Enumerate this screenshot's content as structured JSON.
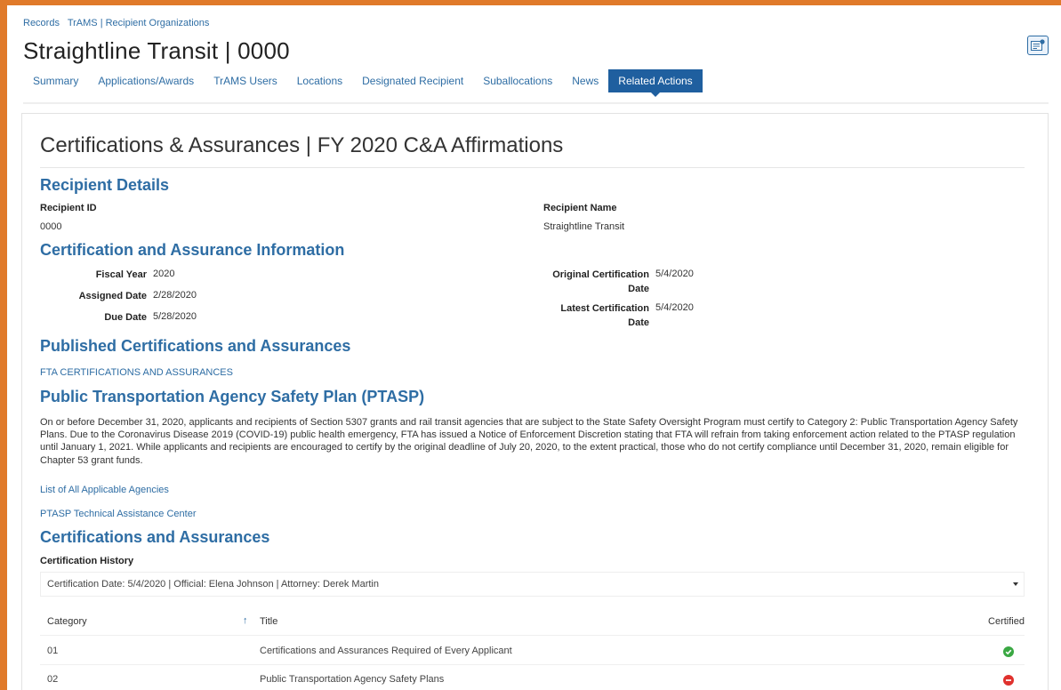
{
  "breadcrumb": [
    "Records",
    "TrAMS | Recipient Organizations"
  ],
  "page_title": "Straightline Transit | 0000",
  "tabs": [
    {
      "label": "Summary"
    },
    {
      "label": "Applications/Awards"
    },
    {
      "label": "TrAMS Users"
    },
    {
      "label": "Locations"
    },
    {
      "label": "Designated Recipient"
    },
    {
      "label": "Suballocations"
    },
    {
      "label": "News"
    },
    {
      "label": "Related Actions",
      "active": true
    }
  ],
  "report_icon": "report-icon",
  "main": {
    "title": "Certifications & Assurances | FY 2020 C&A Affirmations",
    "recipient_details": {
      "heading": "Recipient Details",
      "id_label": "Recipient ID",
      "id_value": "0000",
      "name_label": "Recipient Name",
      "name_value": "Straightline Transit"
    },
    "cert_info": {
      "heading": "Certification and Assurance Information",
      "fiscal_year_label": "Fiscal Year",
      "fiscal_year_value": "2020",
      "assigned_date_label": "Assigned Date",
      "assigned_date_value": "2/28/2020",
      "due_date_label": "Due Date",
      "due_date_value": "5/28/2020",
      "original_cert_label": "Original Certification Date",
      "original_cert_value": "5/4/2020",
      "latest_cert_label": "Latest Certification Date",
      "latest_cert_value": "5/4/2020"
    },
    "published": {
      "heading": "Published Certifications and Assurances",
      "link": "FTA CERTIFICATIONS AND ASSURANCES"
    },
    "ptasp": {
      "heading": "Public Transportation Agency Safety Plan (PTASP)",
      "paragraph": "On or before December 31, 2020, applicants and recipients of Section 5307 grants and rail transit agencies that are subject to the State Safety Oversight Program must certify to Category 2: Public Transportation Agency Safety Plans. Due to the Coronavirus Disease 2019 (COVID-19) public health emergency, FTA has issued a Notice of Enforcement Discretion stating that FTA will refrain from taking enforcement action related to the PTASP regulation until January 1, 2021. While applicants and recipients are encouraged to certify by the original deadline of July 20, 2020, to the extent practical, those who do not certify compliance until December 31, 2020, remain eligible for Chapter 53 grant funds.",
      "link_agencies": "List of All Applicable Agencies",
      "link_tac": "PTASP Technical Assistance Center"
    },
    "cert_assurances": {
      "heading": "Certifications and Assurances",
      "history_label": "Certification History",
      "history_value": "Certification Date: 5/4/2020 | Official: Elena Johnson  | Attorney: Derek Martin",
      "columns": {
        "category": "Category",
        "title": "Title",
        "certified": "Certified"
      },
      "sort_icon": "sort-ascending-icon",
      "rows": [
        {
          "category": "01",
          "title": "Certifications and Assurances Required of Every Applicant",
          "certified": true,
          "status_color": "#3aa843",
          "icon": "check-circle-icon"
        },
        {
          "category": "02",
          "title": "Public Transportation Agency Safety Plans",
          "certified": false,
          "status_color": "#e0312d",
          "icon": "minus-circle-icon"
        }
      ]
    }
  },
  "colors": {
    "accent": "#2e6da4",
    "active_tab": "#1f5f9f",
    "border_frame": "#e07a2a"
  }
}
